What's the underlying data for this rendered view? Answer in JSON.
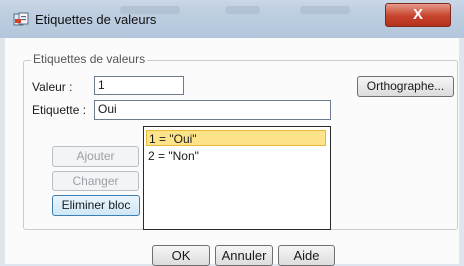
{
  "window": {
    "title": "Etiquettes de valeurs",
    "close_label": "X"
  },
  "group": {
    "label": "Etiquettes de valeurs"
  },
  "valeur": {
    "label": "Valeur :",
    "value": "1"
  },
  "etiquette": {
    "label": "Etiquette :",
    "value": "Oui"
  },
  "buttons": {
    "ajouter": "Ajouter",
    "changer": "Changer",
    "eliminer": "Eliminer bloc",
    "orthographe": "Orthographe..."
  },
  "list": {
    "items": [
      "1 = \"Oui\"",
      "2 = \"Non\""
    ],
    "selected_index": 0
  },
  "footer": {
    "ok": "OK",
    "annuler": "Annuler",
    "aide": "Aide"
  },
  "colors": {
    "titlebar": "#bccde0",
    "close": "#c8432c",
    "selection": "#fde48a"
  }
}
